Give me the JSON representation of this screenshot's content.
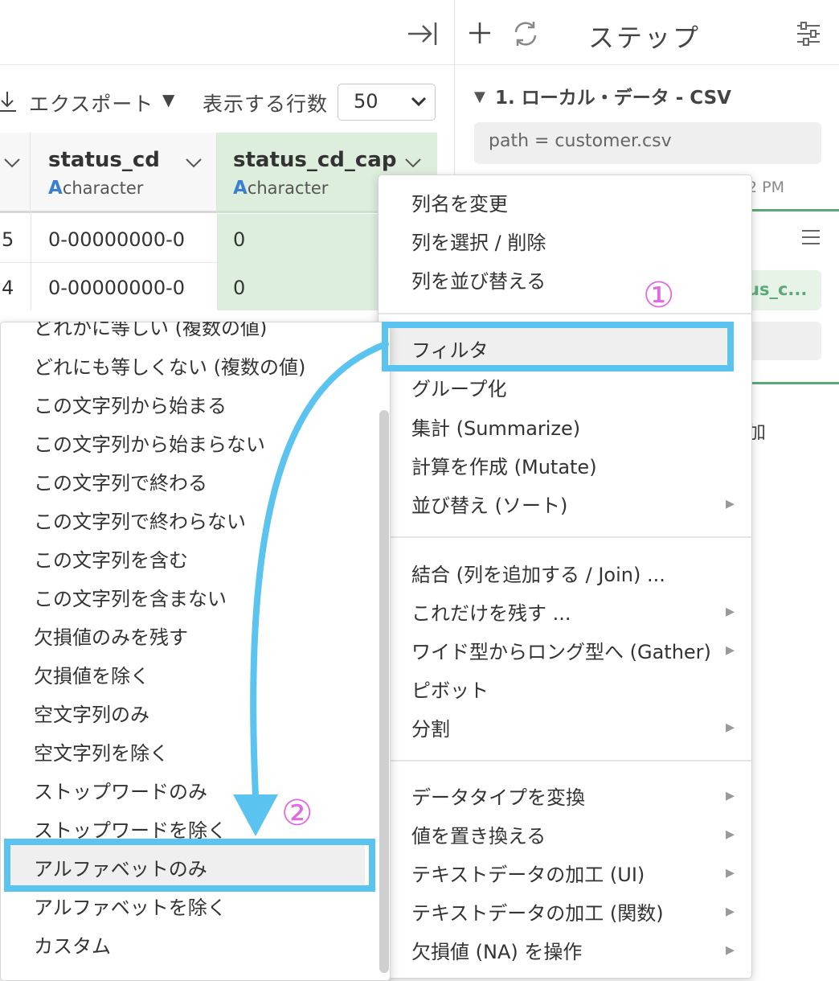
{
  "top": {
    "steps_title": "ステップ"
  },
  "toolbar": {
    "export_label": "エクスポート",
    "rows_label": "表示する行数",
    "rows_value": "50"
  },
  "table": {
    "columns": [
      {
        "name": "status_cd",
        "type": "character"
      },
      {
        "name": "status_cd_cap",
        "type": "character"
      }
    ],
    "type_glyph": "A",
    "rows": [
      {
        "prev": "5",
        "status_cd": "0-00000000-0",
        "status_cd_cap": "0"
      },
      {
        "prev": "4",
        "status_cd": "0-00000000-0",
        "status_cd_cap": "0"
      }
    ]
  },
  "steps": {
    "step1_title": "1. ローカル・データ - CSV",
    "param": "path = customer.csv",
    "time": "2 PM",
    "chip_text": "us_c...",
    "add_text": "加"
  },
  "context_menu": {
    "group1": [
      "列名を変更",
      "列を選択 / 削除",
      "列を並び替える"
    ],
    "group2": [
      "フィルタ",
      "グループ化",
      "集計 (Summarize)",
      "計算を作成 (Mutate)",
      "並び替え (ソート)"
    ],
    "group3": [
      "結合 (列を追加する / Join) ...",
      "これだけを残す ...",
      "ワイド型からロング型へ (Gather)",
      "ピボット",
      "分割"
    ],
    "group4": [
      "データタイプを変換",
      "値を置き換える",
      "テキストデータの加工 (UI)",
      "テキストデータの加工 (関数)",
      "欠損値 (NA) を操作"
    ]
  },
  "filter_menu": {
    "items": [
      "どれかに等しい (複数の値)",
      "どれにも等しくない (複数の値)",
      "この文字列から始まる",
      "この文字列から始まらない",
      "この文字列で終わる",
      "この文字列で終わらない",
      "この文字列を含む",
      "この文字列を含まない",
      "欠損値のみを残す",
      "欠損値を除く",
      "空文字列のみ",
      "空文字列を除く",
      "ストップワードのみ",
      "ストップワードを除く",
      "アルファベットのみ",
      "アルファベットを除く",
      "カスタム"
    ]
  },
  "annotations": {
    "callout1": "①",
    "callout2": "②",
    "accent_color": "#5bc3ef",
    "number_color": "#e06ae0"
  }
}
